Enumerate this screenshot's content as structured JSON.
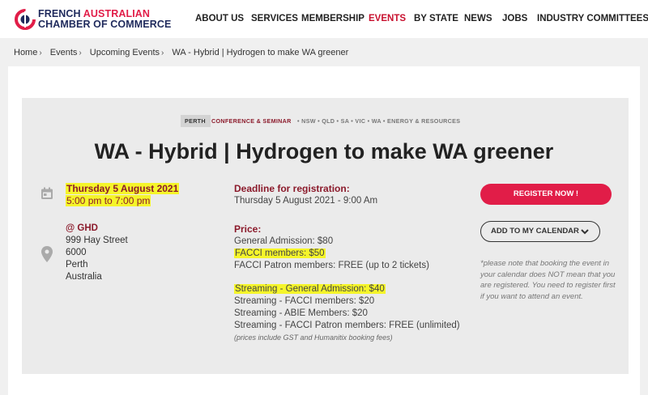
{
  "header": {
    "logo": {
      "line1_a": "FRENCH ",
      "line1_b": "AUSTRALIAN",
      "line2": "CHAMBER OF COMMERCE"
    },
    "nav": [
      "ABOUT US",
      "SERVICES",
      "MEMBERSHIP",
      "EVENTS",
      "BY STATE",
      "NEWS",
      "JOBS",
      "INDUSTRY COMMITTEES"
    ],
    "active_nav": "EVENTS"
  },
  "breadcrumb": {
    "items": [
      "Home",
      "Events",
      "Upcoming Events"
    ],
    "current": "WA - Hybrid | Hydrogen to make WA greener",
    "sep": "›"
  },
  "event": {
    "tags": {
      "state": "PERTH",
      "category": "CONFERENCE & SEMINAR",
      "others": "• NSW • QLD • SA • VIC • WA • ENERGY & RESOURCES"
    },
    "title": "WA - Hybrid | Hydrogen to make WA greener",
    "date": "Thursday 5 August 2021",
    "time": "5:00 pm to 7:00 pm",
    "location": {
      "venue": "@ GHD",
      "street": "999 Hay Street",
      "postcode": "6000",
      "city": "Perth",
      "country": "Australia"
    },
    "deadline": {
      "label": "Deadline for registration:",
      "value": "Thursday 5 August 2021 - 9:00 Am"
    },
    "price": {
      "label": "Price:",
      "lines": [
        "General Admission: $80",
        "FACCI members: $50",
        "FACCI Patron members: FREE (up to 2 tickets)"
      ],
      "streaming_lines": [
        "Streaming - General Admission: $40",
        "Streaming - FACCI members: $20",
        "Streaming - ABIE Members: $20",
        "Streaming - FACCI Patron members: FREE (unlimited)"
      ],
      "note": "(prices include GST and Humanitix booking fees)"
    },
    "register_label": "REGISTER NOW !",
    "calendar_label": "ADD TO MY CALENDAR",
    "calendar_note": "*please note that booking the event in your calendar does NOT mean that you are registered. You need to register first if you want to attend an event."
  },
  "colors": {
    "brand_red": "#e11d48",
    "brand_navy": "#1f2a5c",
    "accent_maroon": "#8b1a2b",
    "highlight": "#f5f52a"
  }
}
